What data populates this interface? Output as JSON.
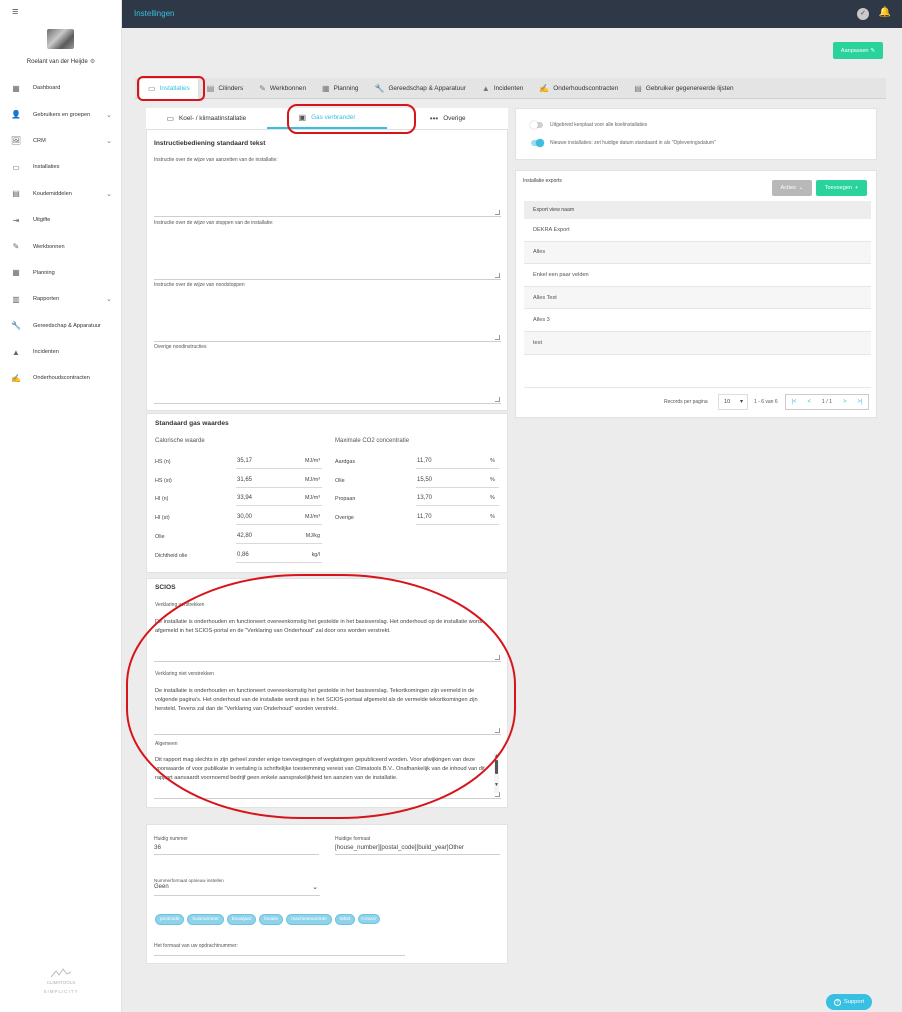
{
  "app": {
    "title": "Instellingen",
    "user_name": "Roelant van der Heijde",
    "user_gear": "⚙"
  },
  "sidebar": {
    "items": [
      {
        "label": "Dashboard",
        "icon": "dashboard-icon",
        "glyph": "▦"
      },
      {
        "label": "Gebruikers en groepen",
        "icon": "user-icon",
        "glyph": "👤",
        "chevron": "⌄"
      },
      {
        "label": "CRM",
        "icon": "crm-icon",
        "glyph": "🖼",
        "chevron": "⌄"
      },
      {
        "label": "Installaties",
        "icon": "installation-icon",
        "glyph": "▭"
      },
      {
        "label": "Koudemiddelen",
        "icon": "refrigerant-icon",
        "glyph": "▤",
        "chevron": "⌄"
      },
      {
        "label": "Uitgifte",
        "icon": "export-icon",
        "glyph": "⇥"
      },
      {
        "label": "Werkbonnen",
        "icon": "workorder-icon",
        "glyph": "✎"
      },
      {
        "label": "Planning",
        "icon": "calendar-icon",
        "glyph": "▦"
      },
      {
        "label": "Rapporten",
        "icon": "report-icon",
        "glyph": "▥",
        "chevron": "⌄"
      },
      {
        "label": "Gereedschap & Apparatuur",
        "icon": "wrench-icon",
        "glyph": "🔧"
      },
      {
        "label": "Incidenten",
        "icon": "warning-icon",
        "glyph": "▲"
      },
      {
        "label": "Onderhoudscontracten",
        "icon": "contract-icon",
        "glyph": "✍"
      }
    ],
    "logo_name": "CLIMATOOLS",
    "logo_tagline": "SIMPLICITY"
  },
  "header": {
    "aanpassen_label": "Aanpassen",
    "aanpassen_icon": "✎"
  },
  "tabs": [
    {
      "label": "Installaties",
      "glyph": "▭"
    },
    {
      "label": "Cilinders",
      "glyph": "▤"
    },
    {
      "label": "Werkbonnen",
      "glyph": "✎"
    },
    {
      "label": "Planning",
      "glyph": "▦"
    },
    {
      "label": "Gereedschap & Apparatuur",
      "glyph": "🔧"
    },
    {
      "label": "Incidenten",
      "glyph": "▲"
    },
    {
      "label": "Onderhoudscontracten",
      "glyph": "✍"
    },
    {
      "label": "Gebruiker gegenereerde lijsten",
      "glyph": "▤"
    }
  ],
  "subtabs": [
    {
      "label": "Koel- / klimaatinstallatie",
      "glyph": "▭"
    },
    {
      "label": "Gas verbrander",
      "glyph": "▣"
    },
    {
      "label": "Overige",
      "glyph": "•••"
    }
  ],
  "instructions": {
    "title": "Instructiebediening standaard tekst",
    "fields": [
      "Instructie over de wijze van aanzetten van de installatie:",
      "Instructie over de wijze van stoppen van de installatie:",
      "Instructie over de wijze van noodstoppen",
      "Overige noodinstructies"
    ]
  },
  "gas": {
    "title": "Standaard gas waardes",
    "left_heading": "Calorische waarde",
    "right_heading": "Maximale CO2 concentratie",
    "left_rows": [
      {
        "label": "HS (n)",
        "value": "35,17",
        "unit": "MJ/m³"
      },
      {
        "label": "HS (st)",
        "value": "31,65",
        "unit": "MJ/m³"
      },
      {
        "label": "HI (n)",
        "value": "33,94",
        "unit": "MJ/m³"
      },
      {
        "label": "HI (st)",
        "value": "30,00",
        "unit": "MJ/m³"
      },
      {
        "label": "Olie",
        "value": "42,80",
        "unit": "MJ/kg"
      },
      {
        "label": "Dichtheid olie",
        "value": "0,86",
        "unit": "kg/l"
      }
    ],
    "right_rows": [
      {
        "label": "Aardgas",
        "value": "11,70",
        "unit": "%"
      },
      {
        "label": "Olie",
        "value": "15,50",
        "unit": "%"
      },
      {
        "label": "Propaan",
        "value": "13,70",
        "unit": "%"
      },
      {
        "label": "Overige",
        "value": "11,70",
        "unit": "%"
      }
    ]
  },
  "scios": {
    "title": "SCIOS",
    "verstrekken_label": "Verklaring verstrekken",
    "verstrekken_text": "De installatie is onderhouden en functioneert overeenkomstig het gestelde in het basisverslag. Het onderhoud op de installatie wordt afgemeld in het SCIOS-portal en de \"Verklaring van Onderhoud\" zal door ons worden verstrekt.",
    "niet_label": "Verklaring niet verstrekken",
    "niet_text": "De installatie is onderhouden en functioneert overeenkomstig het gestelde in het basisverslag. Tekortkomingen zijn vermeld in de volgende pagina's. Het onderhoud van de installatie wordt pas in het SCIOS-portaal afgemeld als de vermelde tekortkomingen zijn hersteld. Tevens zal dan de \"Verklaring van Onderhoud\" worden verstrekt.",
    "algemeen_label": "Algemeen",
    "algemeen_text": "Dit rapport mag slechts in zijn geheel zonder enige toevoegingen of weglatingen gepubliceerd worden. Voor afwijkingen van deze voorwaarde of voor publikatie in vertaling is schriftelijke toestemming vereist van Climatools B.V.. Onafhankelijk van de inhoud van dit rapport aanvaardt voornoemd bedrijf geen enkele aansprakelijkheid ten aanzien van de installatie."
  },
  "numbering": {
    "huidig_nummer_label": "Huidig nummer",
    "huidig_nummer": "36",
    "huidig_formaat_label": "Huidige formaat",
    "huidig_formaat": "[house_number][postal_code][build_year]Other",
    "reset_label": "Nummerformaat opnieuw instellen",
    "reset_value": "Geen",
    "chips": [
      "postcode",
      "huisnummer",
      "bouwjaar",
      "locatie",
      "machinenummer",
      "tekst"
    ],
    "format_chip": "FORMAT",
    "opdracht_label": "Het formaat van uw opdrachtnummer:"
  },
  "settings": {
    "toggle1_label": "Uitgebreid kenplaat voor alle koelinstallaties",
    "toggle1_on": false,
    "toggle2_label": "Nieuwe installaties: zet huidige datum standaard in als \"Opleveringsdatum\"",
    "toggle2_on": true
  },
  "exports": {
    "title": "Installatie exports",
    "acties_label": "Acties",
    "toevoegen_label": "Toevoegen",
    "column": "Export view naam",
    "rows": [
      "DEKRA Export",
      "Alles",
      "Enkel een paar velden",
      "Alles Test",
      "Alles 3",
      "test"
    ],
    "records_label": "Records per pagina",
    "per_page": "10",
    "range": "1 - 6 van 6",
    "page": "1 / 1"
  },
  "support_label": "Support",
  "colors": {
    "accent": "#38c0e3",
    "green": "#2bd39c",
    "topbar": "#2e3846",
    "highlight": "#d8141b"
  }
}
